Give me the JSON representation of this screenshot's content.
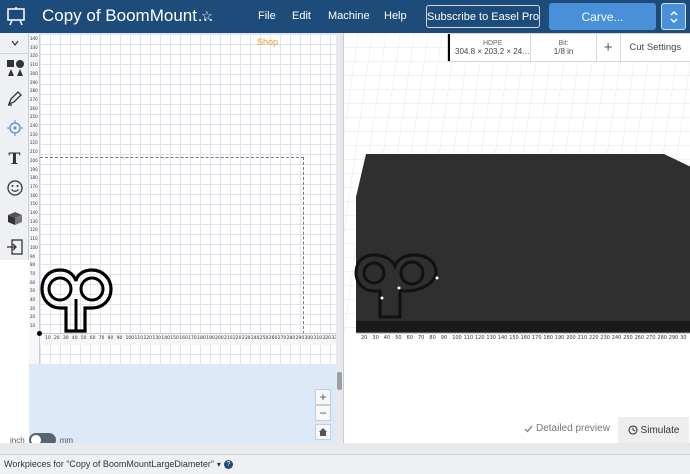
{
  "header": {
    "title": "Copy of BoomMount…",
    "menus": [
      "File",
      "Edit",
      "Machine",
      "Help"
    ],
    "subscribe_label": "Subscribe to Easel Pro",
    "carve_label": "Carve..."
  },
  "canvas": {
    "shop_label": "Shop",
    "y_ticks": [
      "340",
      "330",
      "320",
      "310",
      "300",
      "290",
      "280",
      "270",
      "260",
      "250",
      "240",
      "230",
      "220",
      "210",
      "200",
      "190",
      "180",
      "170",
      "160",
      "150",
      "140",
      "130",
      "120",
      "110",
      "100",
      "90",
      "80",
      "70",
      "60",
      "50",
      "40",
      "30",
      "20",
      "10"
    ],
    "x_ticks": [
      "10",
      "20",
      "30",
      "40",
      "50",
      "60",
      "70",
      "80",
      "90",
      "100",
      "110",
      "120",
      "130",
      "140",
      "150",
      "160",
      "170",
      "180",
      "190",
      "200",
      "210",
      "220",
      "230",
      "240",
      "250",
      "260",
      "270",
      "280",
      "290",
      "300",
      "310",
      "320",
      "330"
    ],
    "zoom_in": "+",
    "zoom_out": "−",
    "units": {
      "left": "inch",
      "right": "mm"
    }
  },
  "panel3d": {
    "material_label": "HDPE",
    "material_size": "304.8 × 203.2 × 24…",
    "bit_label": "Bit:",
    "bit_value": "1/8 in",
    "add_label": "+",
    "cut_settings_label": "Cut Settings",
    "axis_ticks": [
      "20",
      "30",
      "40",
      "50",
      "60",
      "70",
      "80",
      "90",
      "100",
      "110",
      "120",
      "130",
      "140",
      "150",
      "160",
      "170",
      "180",
      "190",
      "200",
      "210",
      "220",
      "230",
      "240",
      "250",
      "260",
      "270",
      "280",
      "290",
      "30"
    ],
    "detailed_preview_label": "Detailed preview",
    "simulate_label": "Simulate"
  },
  "footer": {
    "workpieces_label": "Workpieces for “Copy of BoomMountLargeDiameter”"
  },
  "colors": {
    "header_bg": "#1e4c7a",
    "carve_bg": "#4a90d9",
    "shop": "#e89a2b",
    "canvas_bg": "#dbe9f9",
    "material_top": "#2f2f2f"
  },
  "icons": [
    "easel-app-icon",
    "star-icon",
    "expand-icon",
    "shapes-icon",
    "pen-icon",
    "target-icon",
    "text-icon",
    "emoji-icon",
    "box-icon",
    "import-icon",
    "zoom-in-icon",
    "zoom-out-icon",
    "home-icon",
    "chevron-right-icon",
    "chevron-left-icon",
    "check-icon",
    "clock-icon",
    "help-icon",
    "dropdown-icon"
  ]
}
